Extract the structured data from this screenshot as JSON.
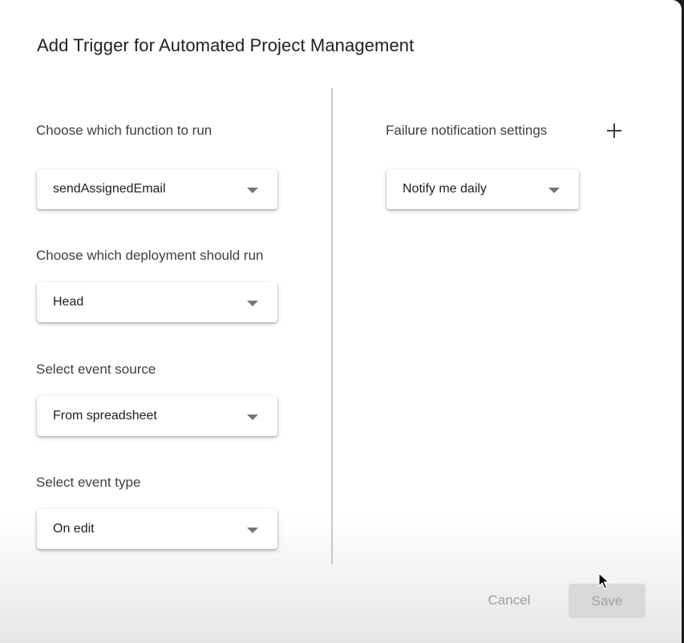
{
  "dialog": {
    "title": "Add Trigger for Automated Project Management"
  },
  "left": {
    "function": {
      "label": "Choose which function to run",
      "value": "sendAssignedEmail"
    },
    "deployment": {
      "label": "Choose which deployment should run",
      "value": "Head"
    },
    "event_source": {
      "label": "Select event source",
      "value": "From spreadsheet"
    },
    "event_type": {
      "label": "Select event type",
      "value": "On edit"
    }
  },
  "right": {
    "failure": {
      "label": "Failure notification settings",
      "value": "Notify me daily",
      "add_icon": "plus-icon"
    }
  },
  "footer": {
    "cancel_label": "Cancel",
    "save_label": "Save"
  },
  "icons": {
    "dropdown": "caret-down-icon",
    "cursor": "mouse-pointer-icon"
  },
  "colors": {
    "title": "#202124",
    "label": "#3c4043",
    "disabled_text": "#9aa0a6",
    "save_bg": "#d9d9d9"
  }
}
